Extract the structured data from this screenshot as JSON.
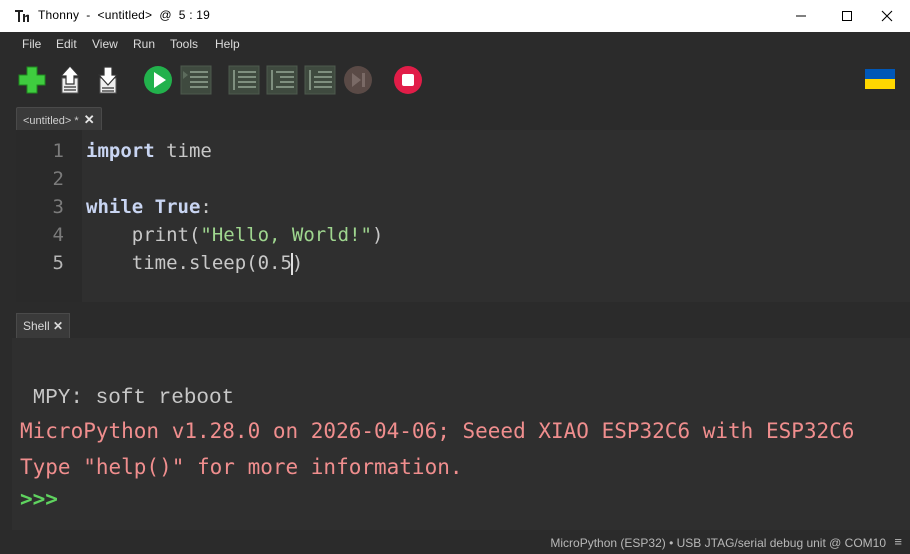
{
  "window": {
    "title": "Thonny  -  <untitled>  @  5 : 19",
    "icon": "thonny-icon"
  },
  "menu": [
    "File",
    "Edit",
    "View",
    "Run",
    "Tools",
    "Help"
  ],
  "toolbar": {
    "buttons": [
      "new-file-icon",
      "open-file-icon",
      "save-file-icon",
      "run-icon",
      "debug-icon",
      "step-over-icon",
      "step-into-icon",
      "step-out-icon",
      "resume-icon",
      "stop-icon"
    ],
    "flag_colors": [
      "#0057b7",
      "#ffd700"
    ]
  },
  "editor": {
    "tab_label": "<untitled> *",
    "tab_close": "✕",
    "line_numbers": [
      "1",
      "2",
      "3",
      "4",
      "5"
    ],
    "lines": {
      "l1_kw": "import",
      "l1_rest": " time",
      "l3_kw1": "while",
      "l3_kw2": "True",
      "l3_rest": ":",
      "l4_pre": "    print(",
      "l4_str": "\"Hello, World!\"",
      "l4_post": ")",
      "l5_pre": "    time.sleep(0.5",
      "l5_post": ")"
    }
  },
  "shell": {
    "tab_label": "Shell",
    "tab_close": "✕",
    "lines": [
      " MPY: soft reboot",
      "MicroPython v1.28.0 on 2026-04-06; Seeed XIAO ESP32C6 with ESP32C6",
      "Type \"help()\" for more information.",
      ">>>"
    ]
  },
  "statusbar": {
    "text": "MicroPython (ESP32)  •  USB JTAG/serial debug unit @ COM10",
    "menu_icon": "≡"
  },
  "colors": {
    "background": "#2b2b2b",
    "editor_bg": "#2f2f2f",
    "shell_error": "#f08e8e",
    "prompt": "#5fd35f",
    "string": "#9fd68f"
  }
}
